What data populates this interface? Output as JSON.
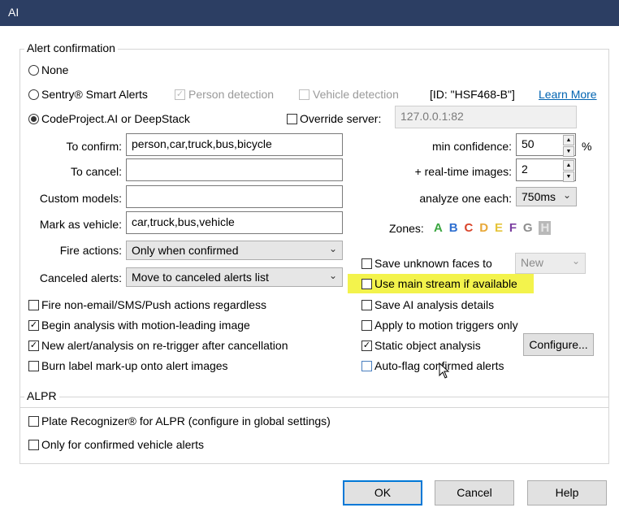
{
  "window": {
    "title": "AI"
  },
  "alert_confirmation": {
    "legend": "Alert confirmation",
    "radio_none": "None",
    "radio_sentry": "Sentry® Smart Alerts",
    "person_detection": "Person detection",
    "vehicle_detection": "Vehicle detection",
    "id_label": "[ID: \"HSF468-B\"]",
    "learn_more": "Learn More",
    "radio_codeproject": "CodeProject.AI or DeepStack",
    "override_server": "Override server:",
    "server_value": "127.0.0.1:82",
    "to_confirm_label": "To confirm:",
    "to_confirm_value": "person,car,truck,bus,bicycle",
    "to_cancel_label": "To cancel:",
    "to_cancel_value": "",
    "custom_models_label": "Custom models:",
    "custom_models_value": "",
    "mark_vehicle_label": "Mark as vehicle:",
    "mark_vehicle_value": "car,truck,bus,vehicle",
    "fire_actions_label": "Fire actions:",
    "fire_actions_value": "Only when confirmed",
    "canceled_alerts_label": "Canceled alerts:",
    "canceled_alerts_value": "Move to canceled alerts list",
    "min_confidence_label": "min confidence:",
    "min_confidence_value": "50",
    "percent": "%",
    "realtime_label": "+ real-time images:",
    "realtime_value": "2",
    "analyze_label": "analyze one each:",
    "analyze_value": "750ms",
    "zones_label": "Zones:",
    "zones": [
      "A",
      "B",
      "C",
      "D",
      "E",
      "F",
      "G",
      "H"
    ],
    "zone_colors": [
      "#3aa640",
      "#2e6fd0",
      "#d9442a",
      "#e8a838",
      "#e5c43a",
      "#7a3ea0",
      "#8e8e8e",
      "#b9b9b9"
    ],
    "save_unknown_faces": "Save unknown faces to",
    "faces_dest": "New",
    "use_main_stream": "Use main stream if available",
    "save_ai_details": "Save AI analysis details",
    "apply_motion": "Apply to motion triggers only",
    "static_object": "Static object analysis",
    "configure": "Configure...",
    "auto_flag": "Auto-flag confirmed alerts",
    "fire_non_email": "Fire non-email/SMS/Push actions regardless",
    "begin_analysis": "Begin analysis with motion-leading image",
    "new_alert": "New alert/analysis on re-trigger after cancellation",
    "burn_label": "Burn label mark-up onto alert images",
    "highlight_color": "#f3f34c",
    "check_mark": "✓"
  },
  "alpr": {
    "legend": "ALPR",
    "plate_recognizer": "Plate Recognizer® for ALPR (configure in global settings)",
    "only_confirmed": "Only for confirmed vehicle alerts"
  },
  "footer": {
    "ok": "OK",
    "cancel": "Cancel",
    "help": "Help"
  }
}
